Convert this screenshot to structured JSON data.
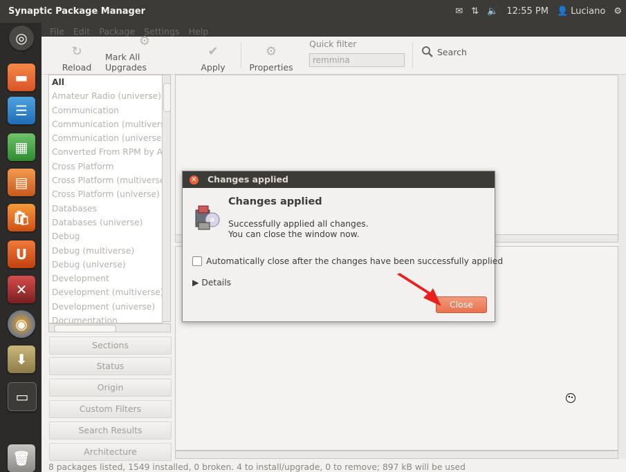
{
  "panel": {
    "title": "Synaptic Package Manager",
    "time": "12:55 PM",
    "user": "Luciano"
  },
  "menu": [
    "File",
    "Edit",
    "Package",
    "Settings",
    "Help"
  ],
  "toolbar": {
    "reload": "Reload",
    "mark_all": "Mark All Upgrades",
    "apply": "Apply",
    "properties": "Properties",
    "quick_filter_label": "Quick filter",
    "quick_filter_value": "remmina",
    "search": "Search"
  },
  "sections": [
    "All",
    "Amateur Radio (universe)",
    "Communication",
    "Communication (multiverse)",
    "Communication (universe)",
    "Converted From RPM by Alien",
    "Cross Platform",
    "Cross Platform (multiverse)",
    "Cross Platform (universe)",
    "Databases",
    "Databases (universe)",
    "Debug",
    "Debug (multiverse)",
    "Debug (universe)",
    "Development",
    "Development (multiverse)",
    "Development (universe)",
    "Documentation"
  ],
  "filter_buttons": [
    "Sections",
    "Status",
    "Origin",
    "Custom Filters",
    "Search Results",
    "Architecture"
  ],
  "status_bar": "8 packages listed, 1549 installed, 0 broken. 4 to install/upgrade, 0 to remove; 897 kB will be used",
  "dialog": {
    "window_title": "Changes applied",
    "heading": "Changes applied",
    "message_line1": "Successfully applied all changes.",
    "message_line2": "You can close the window now.",
    "auto_close": "Automatically close after the changes have been successfully applied",
    "details": "Details",
    "close": "Close"
  },
  "colors": {
    "panel_bg": "#3c3b37",
    "accent": "#e8714d",
    "arrow": "#e8201e"
  }
}
